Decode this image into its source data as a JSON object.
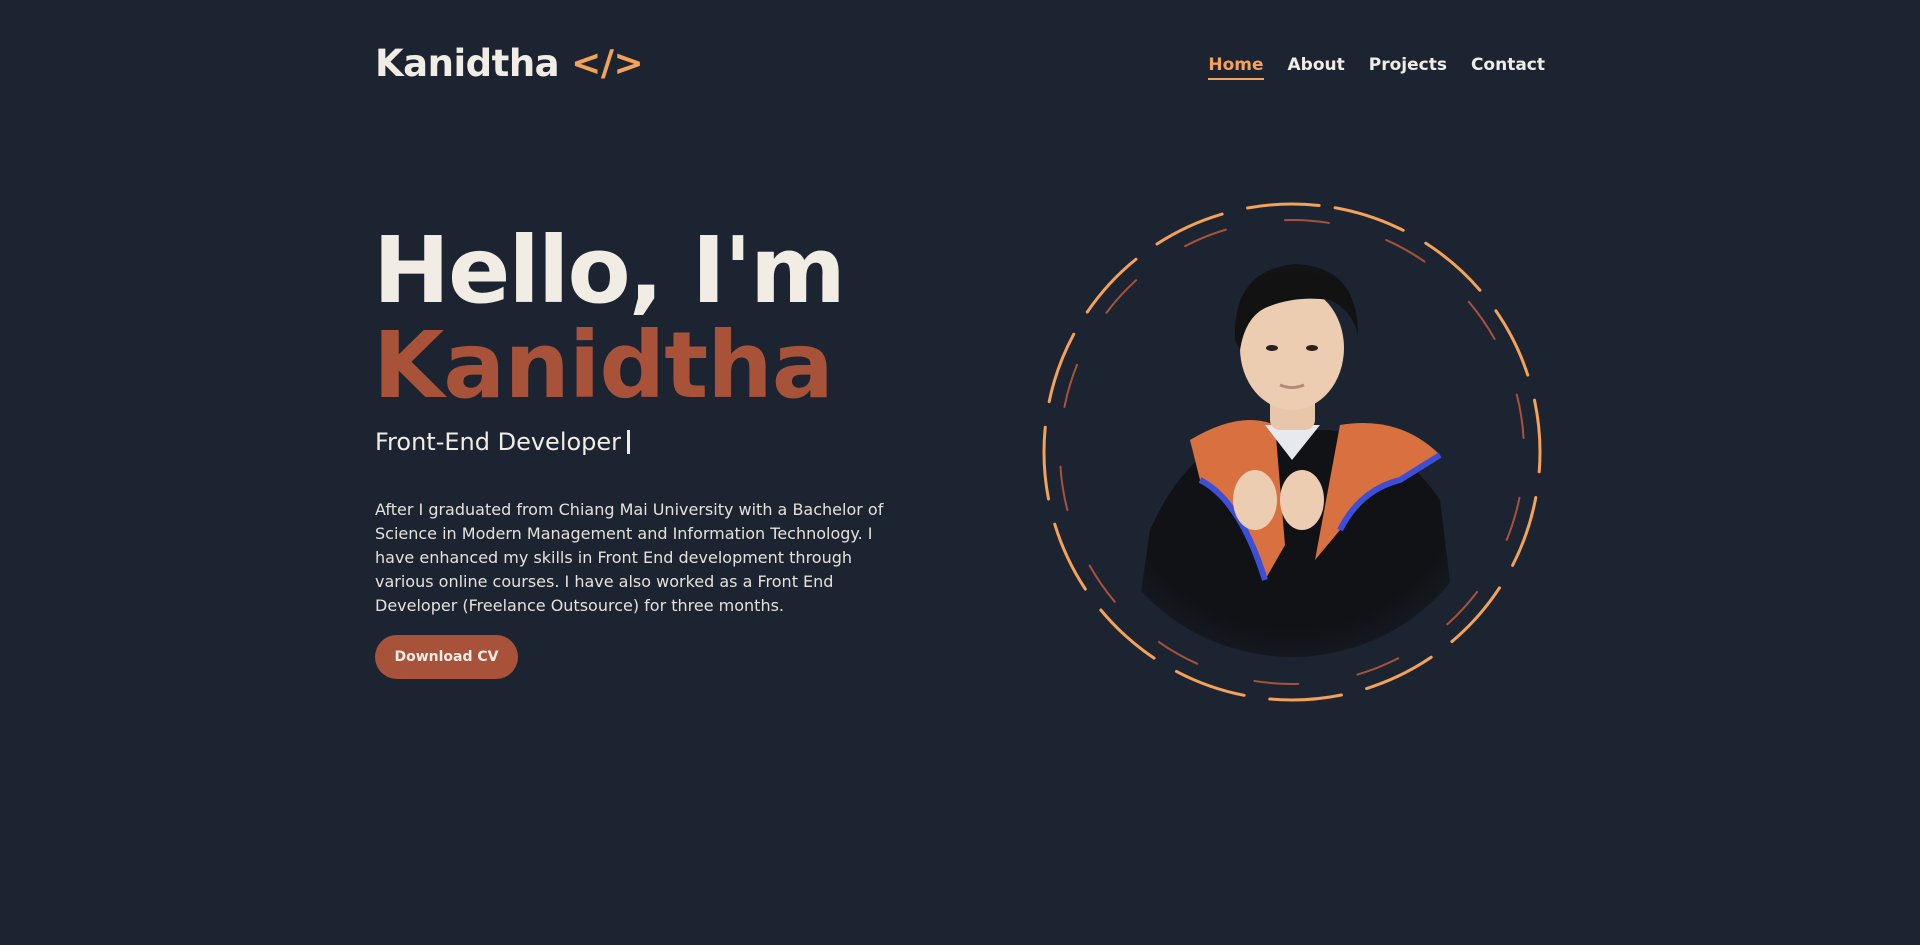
{
  "brand": {
    "name": "Kanidtha",
    "code_glyph": "</>",
    "accent": "#f4a259",
    "primary": "#a8523a",
    "background": "#1c2431"
  },
  "nav": {
    "items": [
      {
        "label": "Home",
        "active": true
      },
      {
        "label": "About",
        "active": false
      },
      {
        "label": "Projects",
        "active": false
      },
      {
        "label": "Contact",
        "active": false
      }
    ]
  },
  "hero": {
    "greeting": "Hello, I'm",
    "name": "Kanidtha",
    "role": "Front-End Developer",
    "bio": "After I graduated from Chiang Mai University with a Bachelor of Science in Modern Management and Information Technology. I have enhanced my skills in Front End development through various online courses. I have also worked as a Front End Developer (Freelance Outsource) for three months.",
    "cta_label": "Download CV"
  }
}
